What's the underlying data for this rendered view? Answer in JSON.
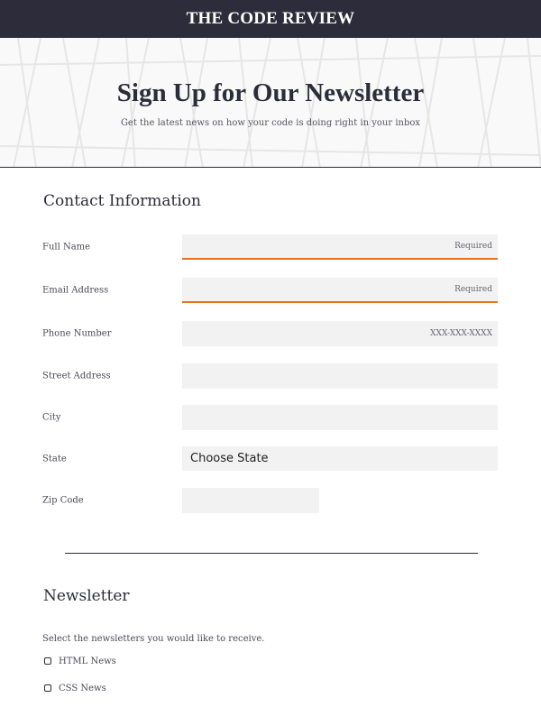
{
  "header": {
    "title": "THE CODE REVIEW"
  },
  "hero": {
    "title": "Sign Up for Our Newsletter",
    "subtitle": "Get the latest news on how your code is doing right in your inbox"
  },
  "contact": {
    "title": "Contact Information",
    "fields": {
      "full_name": {
        "label": "Full Name",
        "placeholder": "Required"
      },
      "email": {
        "label": "Email Address",
        "placeholder": "Required"
      },
      "phone": {
        "label": "Phone Number",
        "placeholder": "XXX-XXX-XXXX"
      },
      "street": {
        "label": "Street Address",
        "placeholder": ""
      },
      "city": {
        "label": "City",
        "placeholder": ""
      },
      "state": {
        "label": "State",
        "selected": "Choose State"
      },
      "zip": {
        "label": "Zip Code",
        "placeholder": ""
      }
    }
  },
  "newsletter": {
    "title": "Newsletter",
    "intro": "Select the newsletters you would like to receive.",
    "options": [
      {
        "label": "HTML News",
        "checked": false
      },
      {
        "label": "CSS News",
        "checked": false
      }
    ]
  },
  "colors": {
    "header_bg": "#2c2c3a",
    "required_accent": "#e8711c",
    "field_bg": "#f2f2f2"
  }
}
